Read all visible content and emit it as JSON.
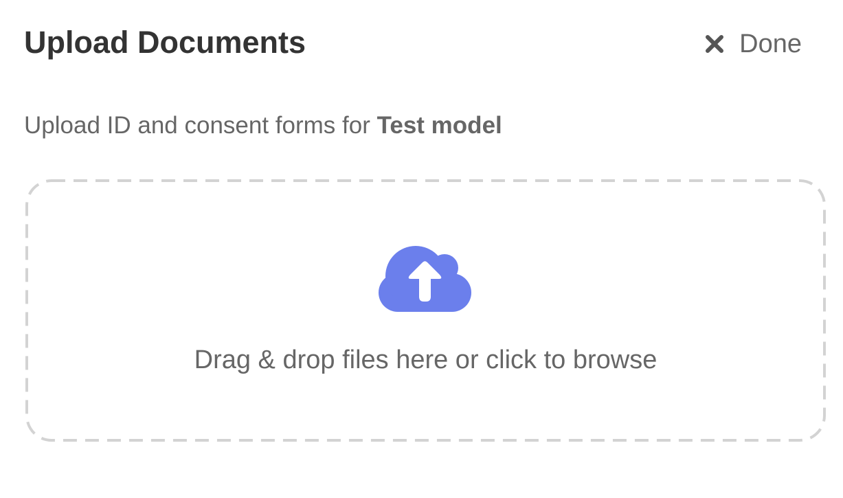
{
  "dialog": {
    "title": "Upload Documents",
    "done_label": "Done",
    "subtitle_prefix": "Upload ID and consent forms for ",
    "model_name": "Test model"
  },
  "dropzone": {
    "instruction": "Drag & drop files here or click to browse",
    "icon": "cloud-upload-icon"
  },
  "colors": {
    "accent": "#6b7fec",
    "border": "#d3d3d3",
    "text_primary": "#333333",
    "text_secondary": "#666666"
  }
}
